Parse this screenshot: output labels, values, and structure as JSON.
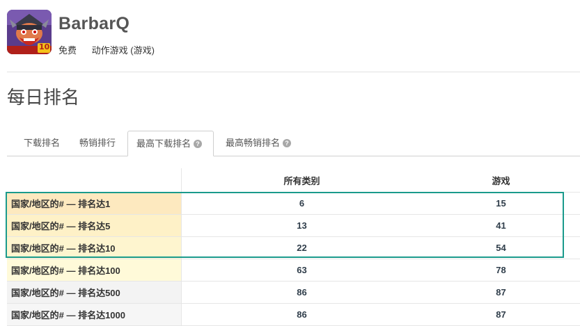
{
  "app": {
    "name": "BarbarQ",
    "price": "免费",
    "category": "动作游戏 (游戏)",
    "icon_badge": "10"
  },
  "page_title": "每日排名",
  "tabs": [
    {
      "label": "下载排名",
      "active": false,
      "help": false
    },
    {
      "label": "畅销排行",
      "active": false,
      "help": false
    },
    {
      "label": "最高下载排名",
      "active": true,
      "help": true
    },
    {
      "label": "最高畅销排名",
      "active": false,
      "help": true
    }
  ],
  "help_glyph": "?",
  "table": {
    "columns": [
      "所有类别",
      "游戏"
    ],
    "rows": [
      {
        "label": "国家/地区的# — 排名达1",
        "all": "6",
        "games": "15",
        "bg": "#fde9bf"
      },
      {
        "label": "国家/地区的# — 排名达5",
        "all": "13",
        "games": "41",
        "bg": "#fef1c7"
      },
      {
        "label": "国家/地区的# — 排名达10",
        "all": "22",
        "games": "54",
        "bg": "#fef5cf"
      },
      {
        "label": "国家/地区的# — 排名达100",
        "all": "63",
        "games": "78",
        "bg": "#fffad9"
      },
      {
        "label": "国家/地区的# — 排名达500",
        "all": "86",
        "games": "87",
        "bg": "#f3f3f3"
      },
      {
        "label": "国家/地区的# — 排名达1000",
        "all": "86",
        "games": "87",
        "bg": "#f6f6f6"
      }
    ]
  },
  "colors": {
    "highlight_border": "#1a9a8c",
    "value_text": "#2f3d4a"
  }
}
